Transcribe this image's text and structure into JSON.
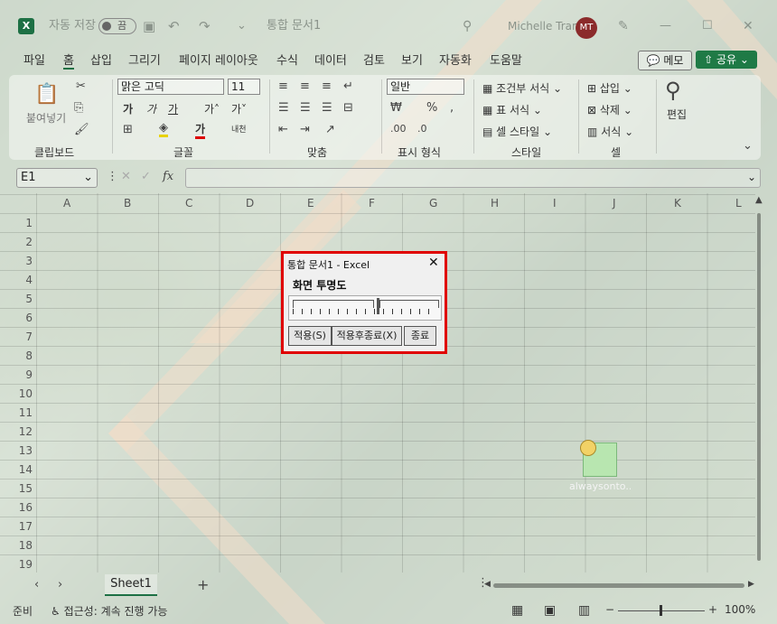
{
  "titlebar": {
    "autosave_label": "자동 저장",
    "autosave_state": "끔",
    "document_title": "통합 문서1",
    "user_name": "Michelle Tran",
    "user_initials": "MT"
  },
  "tabs": [
    "파일",
    "홈",
    "삽입",
    "그리기",
    "페이지 레이아웃",
    "수식",
    "데이터",
    "검토",
    "보기",
    "자동화",
    "도움말"
  ],
  "active_tab": "홈",
  "memo_button": "메모",
  "share_button": "공유",
  "ribbon": {
    "paste_label": "붙여넣기",
    "clipboard_group": "클립보드",
    "font_name": "맑은 고딕",
    "font_size": "11",
    "font_group": "글꼴",
    "align_group": "맞춤",
    "number_format": "일반",
    "number_group": "표시 형식",
    "conditional_label": "조건부 서식",
    "table_label": "표 서식",
    "cellstyle_label": "셀 스타일",
    "style_group": "스타일",
    "insert_label": "삽입",
    "delete_label": "삭제",
    "format_label": "서식",
    "cells_group": "셀",
    "edit_label": "편집"
  },
  "formula": {
    "name_box": "E1",
    "fx": "fx"
  },
  "columns": [
    "A",
    "B",
    "C",
    "D",
    "E",
    "F",
    "G",
    "H",
    "I",
    "J",
    "K",
    "L"
  ],
  "rows": [
    "1",
    "2",
    "3",
    "4",
    "5",
    "6",
    "7",
    "8",
    "9",
    "10",
    "11",
    "12",
    "13",
    "14",
    "15",
    "16",
    "17",
    "18",
    "19"
  ],
  "sheet_tab": "Sheet1",
  "status": {
    "ready": "준비",
    "accessibility": "접근성: 계속 진행 가능",
    "zoom": "100%"
  },
  "dialog": {
    "title": "통합 문서1 - Excel",
    "label": "화면 투명도",
    "slider_fraction": 0.58,
    "apply_button": "적용(S)",
    "apply_close_button": "적용후종료(X)",
    "close_button": "종료"
  },
  "desktop_icon": {
    "label": "alwaysonto..."
  },
  "colors": {
    "accent": "#1d7044",
    "highlight_border": "#e00000"
  }
}
